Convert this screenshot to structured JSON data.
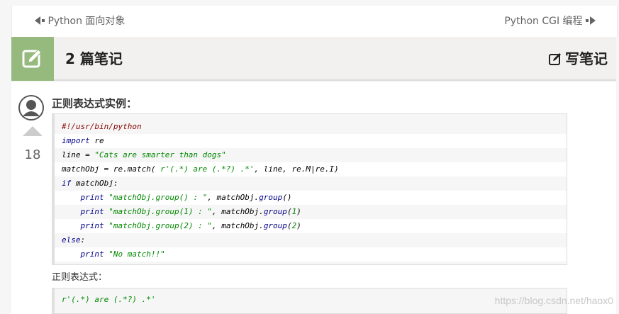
{
  "nav": {
    "prev_label": "Python 面向对象",
    "next_label": "Python CGI 编程"
  },
  "notes_header": {
    "title": "2 篇笔记",
    "write_label": "写笔记",
    "accent_color": "#96b97d"
  },
  "note": {
    "title": "正则表达式实例：",
    "votes": "18",
    "code_lines": [
      {
        "indent": "",
        "parts": [
          {
            "t": "#!/usr/bin/python",
            "c": "cm"
          }
        ]
      },
      {
        "indent": "",
        "parts": [
          {
            "t": "import",
            "c": "kw"
          },
          {
            "t": " re",
            "c": "plain"
          }
        ]
      },
      {
        "indent": "",
        "parts": [
          {
            "t": "line = ",
            "c": "plain"
          },
          {
            "t": "\"Cats are smarter than dogs\"",
            "c": "str"
          }
        ]
      },
      {
        "indent": "",
        "parts": [
          {
            "t": "matchObj = re.match( ",
            "c": "plain"
          },
          {
            "t": "r'(.*) are (.*?) .*'",
            "c": "str"
          },
          {
            "t": ", line, re.M|re.I)",
            "c": "plain"
          }
        ]
      },
      {
        "indent": "",
        "parts": [
          {
            "t": "if",
            "c": "kw"
          },
          {
            "t": " matchObj:",
            "c": "plain"
          }
        ]
      },
      {
        "indent": "    ",
        "parts": [
          {
            "t": "print",
            "c": "kw"
          },
          {
            "t": " ",
            "c": "plain"
          },
          {
            "t": "\"matchObj.group() : \"",
            "c": "str"
          },
          {
            "t": ", matchObj.",
            "c": "plain"
          },
          {
            "t": "group",
            "c": "kw"
          },
          {
            "t": "()",
            "c": "plain"
          }
        ]
      },
      {
        "indent": "    ",
        "parts": [
          {
            "t": "print",
            "c": "kw"
          },
          {
            "t": " ",
            "c": "plain"
          },
          {
            "t": "\"matchObj.group(1) : \"",
            "c": "str"
          },
          {
            "t": ", matchObj.",
            "c": "plain"
          },
          {
            "t": "group",
            "c": "kw"
          },
          {
            "t": "(",
            "c": "plain"
          },
          {
            "t": "1",
            "c": "str"
          },
          {
            "t": ")",
            "c": "plain"
          }
        ]
      },
      {
        "indent": "    ",
        "parts": [
          {
            "t": "print",
            "c": "kw"
          },
          {
            "t": " ",
            "c": "plain"
          },
          {
            "t": "\"matchObj.group(2) : \"",
            "c": "str"
          },
          {
            "t": ", matchObj.",
            "c": "plain"
          },
          {
            "t": "group",
            "c": "kw"
          },
          {
            "t": "(",
            "c": "plain"
          },
          {
            "t": "2",
            "c": "str"
          },
          {
            "t": ")",
            "c": "plain"
          }
        ]
      },
      {
        "indent": "",
        "parts": [
          {
            "t": "else",
            "c": "kw"
          },
          {
            "t": ":",
            "c": "plain"
          }
        ]
      },
      {
        "indent": "    ",
        "parts": [
          {
            "t": "print",
            "c": "kw"
          },
          {
            "t": " ",
            "c": "plain"
          },
          {
            "t": "\"No match!!\"",
            "c": "str"
          }
        ]
      }
    ],
    "regex_label": "正则表达式：",
    "regex_code": "r'(.*) are (.*?) .*'"
  },
  "watermark": "https://blog.csdn.net/haox0"
}
